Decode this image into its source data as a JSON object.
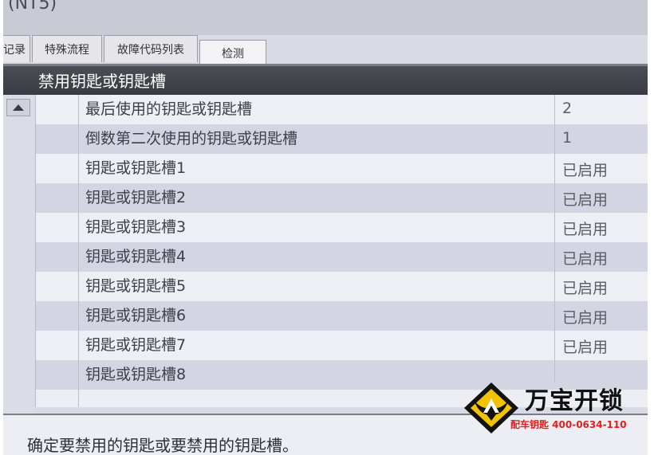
{
  "window": {
    "title_fragment": "(NT5)"
  },
  "tabs": [
    {
      "label": "记录"
    },
    {
      "label": "特殊流程"
    },
    {
      "label": "故障代码列表"
    },
    {
      "label": "检测",
      "active": true
    }
  ],
  "header": {
    "title": "禁用钥匙或钥匙槽"
  },
  "table": {
    "rows": [
      {
        "label": "最后使用的钥匙或钥匙槽",
        "value": "2"
      },
      {
        "label": "倒数第二次使用的钥匙或钥匙槽",
        "value": "1"
      },
      {
        "label": "钥匙或钥匙槽1",
        "value": "已启用"
      },
      {
        "label": "钥匙或钥匙槽2",
        "value": "已启用"
      },
      {
        "label": "钥匙或钥匙槽3",
        "value": "已启用"
      },
      {
        "label": "钥匙或钥匙槽4",
        "value": "已启用"
      },
      {
        "label": "钥匙或钥匙槽5",
        "value": "已启用"
      },
      {
        "label": "钥匙或钥匙槽6",
        "value": "已启用"
      },
      {
        "label": "钥匙或钥匙槽7",
        "value": "已启用"
      },
      {
        "label": "钥匙或钥匙槽8",
        "value": ""
      }
    ]
  },
  "footer": {
    "instruction": "确定要禁用的钥匙或要禁用的钥匙槽。"
  },
  "watermark": {
    "brand": "万宝开锁",
    "tagline": "配车钥匙 400-0634-110"
  },
  "colors": {
    "header_bg": "#43454d",
    "row_light": "#eeeff5",
    "row_dark": "#d3d5e3",
    "watermark_red": "#e02020",
    "watermark_gold": "#f2c200"
  },
  "icons": {
    "scroll_up": "chevron-up-icon",
    "watermark_logo": "horned-helmet-logo"
  }
}
